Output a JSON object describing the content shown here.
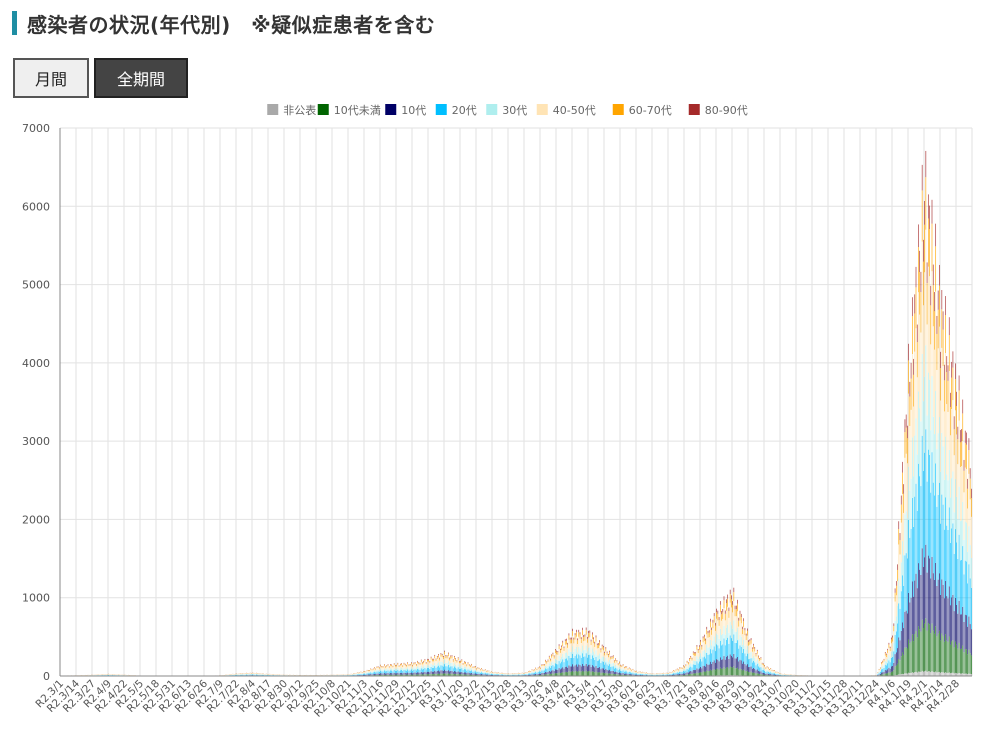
{
  "header": {
    "title": "感染者の状況(年代別)　※疑似症患者を含む"
  },
  "buttons": {
    "monthly_label": "月間",
    "all_period_label": "全期間"
  },
  "colors": {
    "accent": "#1f8ea3",
    "grid": "#e2e2e2"
  },
  "chart_data": {
    "type": "bar",
    "stacked": true,
    "ylim": [
      0,
      7000
    ],
    "yticks": [
      0,
      1000,
      2000,
      3000,
      4000,
      5000,
      6000,
      7000
    ],
    "grid": true,
    "legend_position": "top",
    "tick_labels": [
      "R2.3/1",
      "R2.3/14",
      "R2.3/27",
      "R2.4/9",
      "R2.4/22",
      "R2.5/5",
      "R2.5/18",
      "R2.5/31",
      "R2.6/13",
      "R2.6/26",
      "R2.7/9",
      "R2.7/22",
      "R2.8/4",
      "R2.8/17",
      "R2.8/30",
      "R2.9/12",
      "R2.9/25",
      "R2.10/8",
      "R2.10/21",
      "R2.11/3",
      "R2.11/16",
      "R2.11/29",
      "R2.12/12",
      "R2.12/25",
      "R3.1/7",
      "R3.1/20",
      "R3.2/2",
      "R3.2/15",
      "R3.2/28",
      "R3.3/13",
      "R3.3/26",
      "R3.4/8",
      "R3.4/21",
      "R3.5/4",
      "R3.5/17",
      "R3.5/30",
      "R3.6/12",
      "R3.6/25",
      "R3.7/8",
      "R3.7/21",
      "R3.8/3",
      "R3.8/16",
      "R3.8/29",
      "R3.9/11",
      "R3.9/24",
      "R3.10/7",
      "R3.10/20",
      "R3.11/2",
      "R3.11/15",
      "R3.11/28",
      "R3.12/11",
      "R3.12/24",
      "R4.1/6",
      "R4.1/19",
      "R4.2/1",
      "R4.2/14",
      "R4.2/28"
    ],
    "series": [
      {
        "name": "非公表",
        "color": "#a9a9a9"
      },
      {
        "name": "10代未満",
        "color": "#006400"
      },
      {
        "name": "10代",
        "color": "#000066"
      },
      {
        "name": "20代",
        "color": "#00bfff"
      },
      {
        "name": "30代",
        "color": "#afeeee"
      },
      {
        "name": "40-50代",
        "color": "#ffe4b5"
      },
      {
        "name": "60-70代",
        "color": "#ffa500"
      },
      {
        "name": "80-90代",
        "color": "#a52a2a"
      }
    ],
    "period_totals": [
      {
        "label": "R2.3/1",
        "total": 5
      },
      {
        "label": "R2.3/14",
        "total": 8
      },
      {
        "label": "R2.3/27",
        "total": 15
      },
      {
        "label": "R2.4/9",
        "total": 25
      },
      {
        "label": "R2.4/22",
        "total": 15
      },
      {
        "label": "R2.5/5",
        "total": 5
      },
      {
        "label": "R2.5/18",
        "total": 2
      },
      {
        "label": "R2.5/31",
        "total": 1
      },
      {
        "label": "R2.6/13",
        "total": 1
      },
      {
        "label": "R2.6/26",
        "total": 2
      },
      {
        "label": "R2.7/9",
        "total": 8
      },
      {
        "label": "R2.7/22",
        "total": 30
      },
      {
        "label": "R2.8/4",
        "total": 40
      },
      {
        "label": "R2.8/17",
        "total": 25
      },
      {
        "label": "R2.8/30",
        "total": 15
      },
      {
        "label": "R2.9/12",
        "total": 12
      },
      {
        "label": "R2.9/25",
        "total": 12
      },
      {
        "label": "R2.10/8",
        "total": 15
      },
      {
        "label": "R2.10/21",
        "total": 20
      },
      {
        "label": "R2.11/3",
        "total": 60
      },
      {
        "label": "R2.11/16",
        "total": 130
      },
      {
        "label": "R2.11/29",
        "total": 150
      },
      {
        "label": "R2.12/12",
        "total": 160
      },
      {
        "label": "R2.12/25",
        "total": 210
      },
      {
        "label": "R3.1/7",
        "total": 290
      },
      {
        "label": "R3.1/20",
        "total": 200
      },
      {
        "label": "R3.2/2",
        "total": 110
      },
      {
        "label": "R3.2/15",
        "total": 50
      },
      {
        "label": "R3.2/28",
        "total": 30
      },
      {
        "label": "R3.3/13",
        "total": 40
      },
      {
        "label": "R3.3/26",
        "total": 120
      },
      {
        "label": "R3.4/8",
        "total": 330
      },
      {
        "label": "R3.4/21",
        "total": 540
      },
      {
        "label": "R3.5/4",
        "total": 560
      },
      {
        "label": "R3.5/17",
        "total": 350
      },
      {
        "label": "R3.5/30",
        "total": 150
      },
      {
        "label": "R3.6/12",
        "total": 60
      },
      {
        "label": "R3.6/25",
        "total": 30
      },
      {
        "label": "R3.7/8",
        "total": 40
      },
      {
        "label": "R3.7/21",
        "total": 130
      },
      {
        "label": "R3.8/3",
        "total": 420
      },
      {
        "label": "R3.8/16",
        "total": 800
      },
      {
        "label": "R3.8/29",
        "total": 1050
      },
      {
        "label": "R3.9/11",
        "total": 500
      },
      {
        "label": "R3.9/24",
        "total": 130
      },
      {
        "label": "R3.10/7",
        "total": 30
      },
      {
        "label": "R3.10/20",
        "total": 12
      },
      {
        "label": "R3.11/2",
        "total": 5
      },
      {
        "label": "R3.11/15",
        "total": 3
      },
      {
        "label": "R3.11/28",
        "total": 3
      },
      {
        "label": "R3.12/11",
        "total": 3
      },
      {
        "label": "R3.12/24",
        "total": 10
      },
      {
        "label": "R4.1/6",
        "total": 500
      },
      {
        "label": "R4.1/19",
        "total": 3800
      },
      {
        "label": "R4.2/1",
        "total": 6200
      },
      {
        "label": "R4.2/14",
        "total": 4700
      },
      {
        "label": "R4.2/28",
        "total": 3600
      }
    ]
  }
}
